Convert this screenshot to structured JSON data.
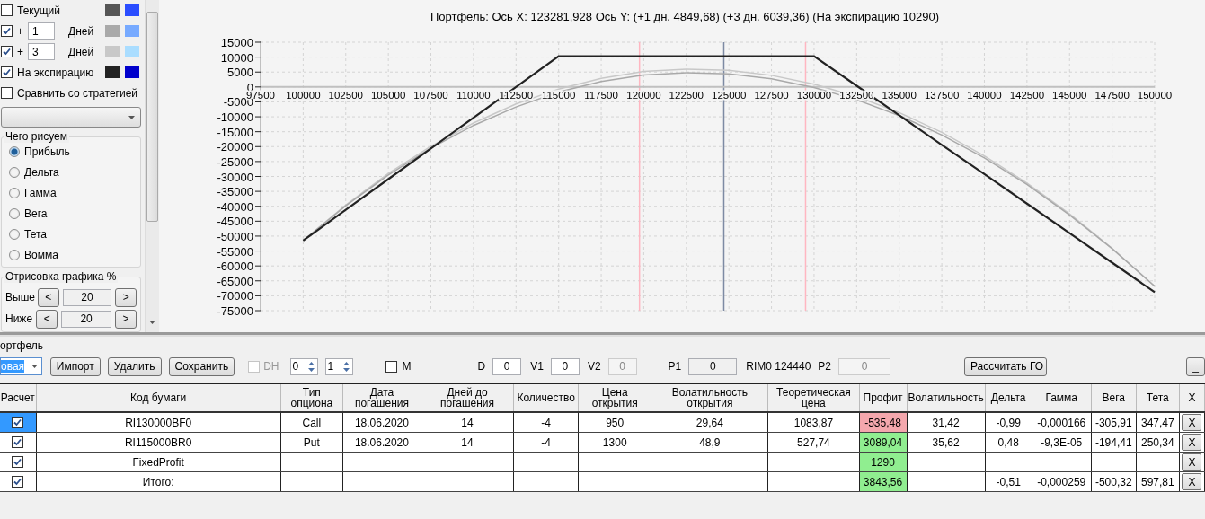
{
  "display": {
    "rows": [
      {
        "kind": "current",
        "label": "Текущий",
        "checked": false,
        "swatches": [
          {
            "color": "#555555"
          },
          {
            "color": "#2a4dff"
          }
        ]
      },
      {
        "kind": "days",
        "prefix": "+",
        "value": "1",
        "unit": "Дней",
        "checked": true,
        "swatches": [
          {
            "color": "#a9a9a9"
          },
          {
            "color": "#77aaff"
          }
        ]
      },
      {
        "kind": "days",
        "prefix": "+",
        "value": "3",
        "unit": "Дней",
        "checked": true,
        "swatches": [
          {
            "color": "#c8c8c8"
          },
          {
            "color": "#aaddff"
          }
        ]
      },
      {
        "kind": "expiry",
        "label": "На экспирацию",
        "checked": true,
        "swatches": [
          {
            "color": "#222222"
          },
          {
            "color": "#0000cc"
          }
        ]
      }
    ],
    "compare": {
      "label": "Сравнить со стратегией",
      "checked": false
    },
    "plot_kind": {
      "title": "Чего рисуем",
      "options": [
        {
          "label": "Прибыль",
          "selected": true
        },
        {
          "label": "Дельта",
          "selected": false
        },
        {
          "label": "Гамма",
          "selected": false
        },
        {
          "label": "Вега",
          "selected": false
        },
        {
          "label": "Тета",
          "selected": false
        },
        {
          "label": "Вомма",
          "selected": false
        }
      ]
    },
    "range": {
      "title": "Отрисовка графика %",
      "rows": [
        {
          "label": "Выше",
          "dec": "<",
          "value": "20",
          "inc": ">"
        },
        {
          "label": "Ниже",
          "dec": "<",
          "value": "20",
          "inc": ">"
        }
      ]
    }
  },
  "chart": {
    "chart_data": {
      "type": "line",
      "title": "Портфель: Ось X: 123281,928 Ось Y:  (+1 дн. 4849,68)  (+3 дн. 6039,36)  (На экспирацию 10290)",
      "grid": true,
      "x": [
        100000,
        102500,
        105000,
        107500,
        110000,
        112500,
        115000,
        117500,
        120000,
        122500,
        125000,
        127500,
        130000,
        132500,
        135000,
        137500,
        140000,
        142500,
        145000,
        147500,
        150000
      ],
      "series": [
        {
          "color": "#c8c8c8",
          "values": [
            -51500,
            -39600,
            -29000,
            -19900,
            -12100,
            -5700,
            -700,
            2900,
            5200,
            6000,
            5600,
            3900,
            900,
            -3200,
            -8600,
            -15200,
            -23100,
            -32200,
            -42500,
            -54100,
            -66800
          ]
        },
        {
          "color": "#a9a9a9",
          "values": [
            -51500,
            -39800,
            -29500,
            -20500,
            -12900,
            -6700,
            -1700,
            1800,
            4000,
            4800,
            4400,
            2700,
            -200,
            -4300,
            -9600,
            -16100,
            -23800,
            -32700,
            -42900,
            -54200,
            -66800
          ]
        },
        {
          "color": "#222222",
          "values": [
            -51500,
            -41200,
            -30900,
            -20600,
            -10300,
            0,
            10300,
            10300,
            10300,
            10300,
            10300,
            10300,
            10300,
            400,
            -9500,
            -19400,
            -29200,
            -39100,
            -49000,
            -58900,
            -68800
          ]
        }
      ],
      "xlim": [
        97500,
        150000
      ],
      "ylim": [
        -75000,
        15000
      ],
      "xticks": [
        97500,
        100000,
        102500,
        105000,
        107500,
        110000,
        112500,
        115000,
        117500,
        120000,
        122500,
        125000,
        127500,
        130000,
        132500,
        135000,
        137500,
        140000,
        142500,
        145000,
        147500,
        150000
      ],
      "yticks": [
        15000,
        10000,
        5000,
        0,
        -5000,
        -10000,
        -15000,
        -20000,
        -25000,
        -30000,
        -35000,
        -40000,
        -45000,
        -50000,
        -55000,
        -60000,
        -65000,
        -70000,
        -75000
      ],
      "ref_lines": [
        {
          "axis": "x",
          "value": 119750,
          "color": "#ffb6c1"
        },
        {
          "axis": "x",
          "value": 129500,
          "color": "#ffb6c1"
        },
        {
          "axis": "x",
          "value": 124700,
          "color": "#7d8aa3"
        }
      ]
    }
  },
  "portfolio": {
    "title": "ортфель",
    "combo": "овая",
    "buttons": [
      "Импорт",
      "Удалить",
      "Сохранить"
    ],
    "dh": {
      "label": "DH",
      "checked": false,
      "disabled": true
    },
    "spins": [
      "0",
      "1"
    ],
    "m": {
      "label": "M",
      "checked": false
    },
    "fields": [
      {
        "label": "D",
        "value": "0",
        "disabled": false
      },
      {
        "label": "V1",
        "value": "0",
        "disabled": false
      },
      {
        "label": "V2",
        "value": "0",
        "disabled": true
      },
      {
        "label": "P1",
        "value": "0",
        "disabled": false
      }
    ],
    "rim": "RIM0 124440",
    "p2": {
      "label": "P2",
      "value": "0",
      "disabled": true
    },
    "calc_button": "Рассчитать ГО",
    "min_button": "_"
  },
  "table": {
    "columns": [
      "Расчет",
      "Код бумаги",
      "Тип опциона",
      "Дата погашения",
      "Дней до погашения",
      "Количество",
      "Цена открытия",
      "Волатильность открытия",
      "Теоретическая цена",
      "Профит",
      "Волатильность",
      "Дельта",
      "Гамма",
      "Вега",
      "Тета",
      "X"
    ],
    "rows": [
      {
        "checked": true,
        "selected": true,
        "color": "#f4a7ad",
        "cells": [
          null,
          "RI130000BF0",
          "Call",
          "18.06.2020",
          "14",
          "-4",
          "950",
          "29,64",
          "1083,87",
          "-535,48",
          "31,42",
          "-0,99",
          "-0,000166",
          "-305,91",
          "347,47",
          "X"
        ]
      },
      {
        "checked": true,
        "selected": false,
        "color": "#90ee90",
        "cells": [
          null,
          "RI115000BR0",
          "Put",
          "18.06.2020",
          "14",
          "-4",
          "1300",
          "48,9",
          "527,74",
          "3089,04",
          "35,62",
          "0,48",
          "-9,3E-05",
          "-194,41",
          "250,34",
          "X"
        ]
      },
      {
        "checked": true,
        "selected": false,
        "color": "#90ee90",
        "cells": [
          null,
          "FixedProfit",
          null,
          null,
          null,
          null,
          null,
          null,
          null,
          "1290",
          null,
          null,
          null,
          null,
          null,
          "X"
        ]
      },
      {
        "checked": true,
        "selected": false,
        "color": "#90ee90",
        "cells": [
          null,
          "Итого:",
          null,
          null,
          null,
          null,
          null,
          null,
          null,
          "3843,56",
          null,
          "-0,51",
          "-0,000259",
          "-500,32",
          "597,81",
          "X"
        ]
      }
    ]
  }
}
